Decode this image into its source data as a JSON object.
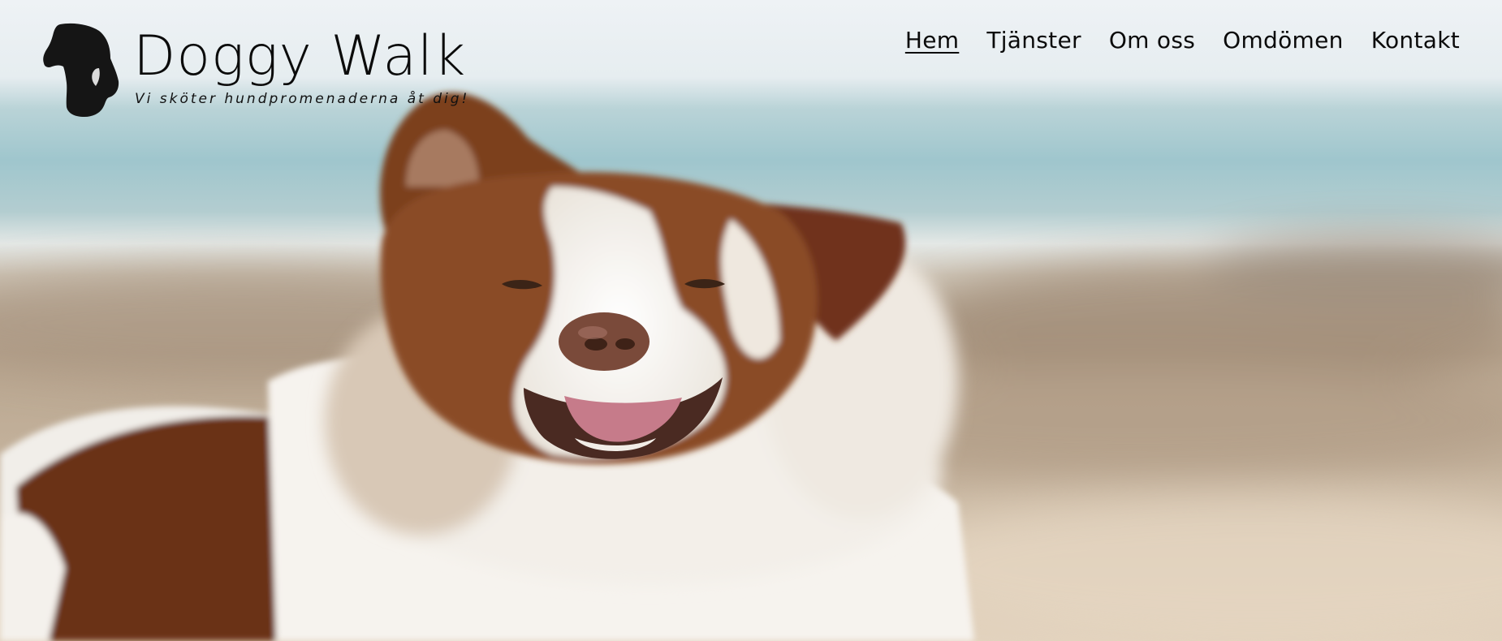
{
  "brand": {
    "name": "Doggy Walk",
    "tagline": "Vi sköter hundpromenaderna åt dig!",
    "logo_icon": "dog-head-silhouette-icon"
  },
  "nav": {
    "items": [
      {
        "label": "Hem",
        "active": true
      },
      {
        "label": "Tjänster",
        "active": false
      },
      {
        "label": "Om oss",
        "active": false
      },
      {
        "label": "Omdömen",
        "active": false
      },
      {
        "label": "Kontakt",
        "active": false
      }
    ]
  },
  "hero": {
    "image_subject": "smiling brown-and-white dog on a blurred beach"
  },
  "colors": {
    "text": "#0b0b0b",
    "sky": "#eef2f5",
    "sea": "#9fc6cd",
    "sand": "#c8b7a2",
    "fur_brown": "#7a3c1e",
    "fur_white": "#f4f1ec"
  }
}
